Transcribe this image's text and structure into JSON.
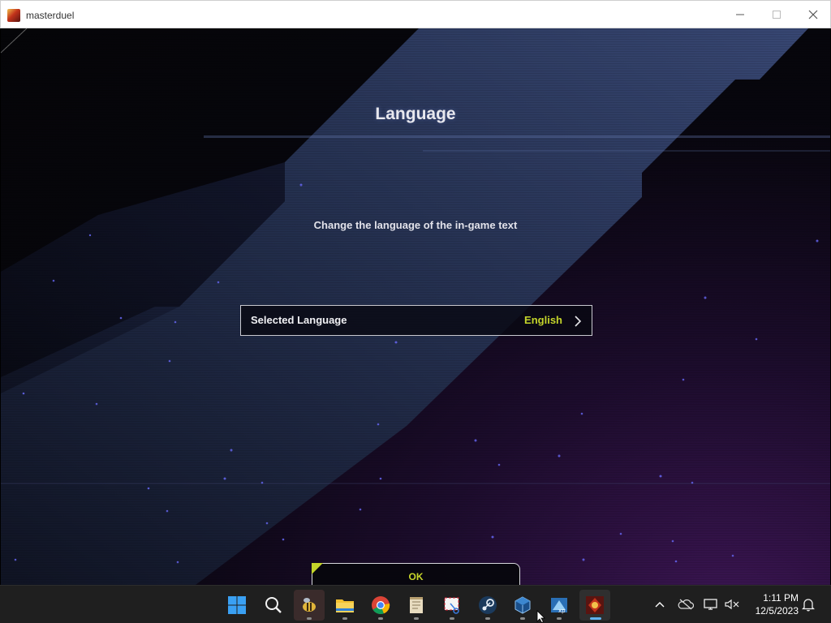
{
  "window": {
    "title": "masterduel",
    "icon": "masterduel-app-icon",
    "controls": [
      "minimize-icon",
      "maximize-icon",
      "close-icon"
    ]
  },
  "screen": {
    "title": "Language",
    "description": "Change the language of the in-game text",
    "setting": {
      "label": "Selected Language",
      "value": "English",
      "icon": "chevron-right-icon"
    },
    "ok_button": "OK"
  },
  "colors": {
    "accent": "#c4d42a",
    "background": "#07060d",
    "panel_stripe": "#2b3660"
  },
  "taskbar": {
    "apps": [
      {
        "name": "start",
        "icon": "windows-start-icon"
      },
      {
        "name": "search",
        "icon": "search-icon"
      },
      {
        "name": "bee-app",
        "icon": "bee-icon"
      },
      {
        "name": "file-explorer",
        "icon": "folder-icon"
      },
      {
        "name": "chrome",
        "icon": "chrome-icon"
      },
      {
        "name": "notepad",
        "icon": "notepad-icon"
      },
      {
        "name": "snipping-tool",
        "icon": "snipping-tool-icon"
      },
      {
        "name": "steam",
        "icon": "steam-icon"
      },
      {
        "name": "virtualbox",
        "icon": "virtualbox-icon"
      },
      {
        "name": "xp-app",
        "icon": "xp-icon"
      },
      {
        "name": "masterduel",
        "icon": "masterduel-icon"
      }
    ],
    "tray": [
      "chevron-up-icon",
      "onedrive-offline-icon",
      "network-icon",
      "volume-muted-icon"
    ],
    "time": "1:11 PM",
    "date": "12/5/2023",
    "notification_icon": "bell-icon"
  }
}
